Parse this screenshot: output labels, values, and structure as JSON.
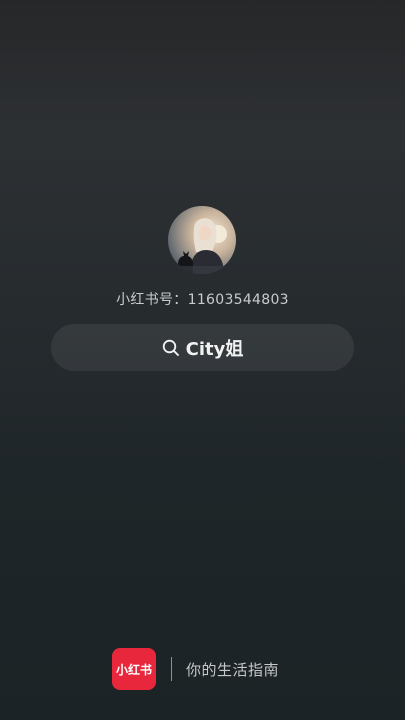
{
  "profile": {
    "account_id_text": "小红书号：11603544803"
  },
  "search": {
    "query_text": "City姐"
  },
  "footer": {
    "logo_text": "小红书",
    "slogan": "你的生活指南"
  },
  "colors": {
    "brand": "#e8273d",
    "background_top": "#262729",
    "background_bottom": "#1b2326"
  },
  "icons": {
    "search": "search-icon"
  }
}
